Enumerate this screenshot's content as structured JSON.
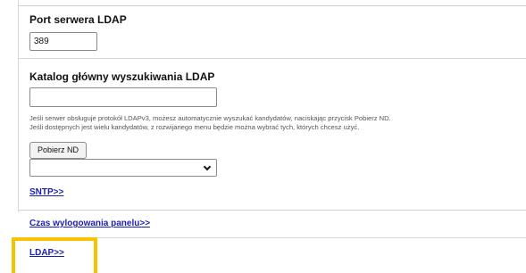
{
  "ldap_port": {
    "label": "Port serwera LDAP",
    "value": "389"
  },
  "ldap_base_dn": {
    "label": "Katalog główny wyszukiwania LDAP",
    "value": "",
    "help_line_1": "Jeśli serwer obsługuje protokół LDAPv3, możesz automatycznie wyszukać kandydatów, naciskając przycisk Pobierz ND.",
    "help_line_2": "Jeśli dostępnych jest wielu kandydatów, z rozwijanego menu będzie można wybrać tych, których chcesz użyć.",
    "fetch_button_label": "Pobierz ND",
    "candidates_selected": ""
  },
  "links": {
    "sntp": "SNTP>>",
    "panel_logout_time": "Czas wylogowania panelu>>",
    "ldap": "LDAP>>"
  },
  "colors": {
    "highlight": "#f5c400",
    "link": "#1a1fb8"
  }
}
